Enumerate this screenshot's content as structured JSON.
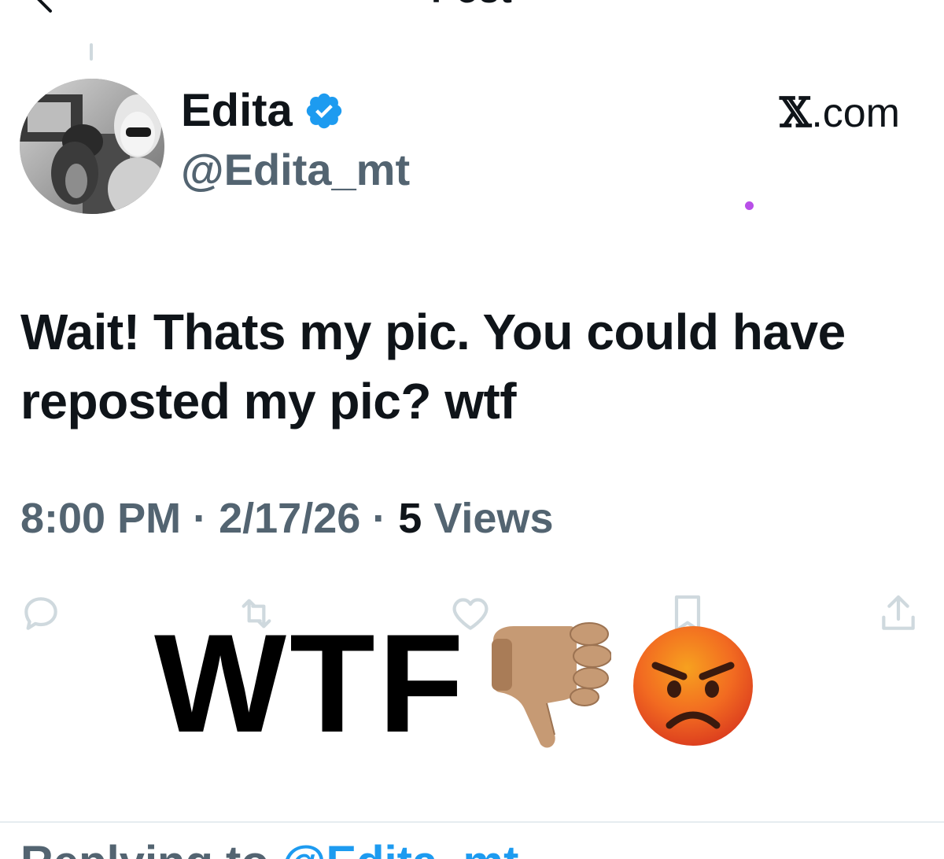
{
  "header": {
    "title": "Post",
    "back_icon": "arrow-left-icon"
  },
  "author": {
    "display_name": "Edita",
    "handle": "@Edita_mt",
    "verified": true,
    "verified_color": "#1d9bf0"
  },
  "brand": {
    "x_letter": "𝕏",
    "suffix": ".com"
  },
  "post": {
    "text": "Wait! Thats my pic. You could have reposted my pic? wtf",
    "time": "8:00 PM",
    "date": "2/17/26",
    "views_count": "5",
    "views_label": "Views",
    "separator": "·"
  },
  "actions": {
    "reply_icon": "reply-icon",
    "repost_icon": "repost-icon",
    "like_icon": "heart-icon",
    "bookmark_icon": "bookmark-icon",
    "share_icon": "share-icon"
  },
  "overlay": {
    "text": "WTF",
    "emoji_1": "thumbs-down-icon",
    "emoji_2": "angry-face-icon"
  },
  "reply_context": {
    "prefix": "Replying to ",
    "mention": "@Edita_mt"
  },
  "colors": {
    "primary_text": "#0f1419",
    "secondary_text": "#536471",
    "accent": "#1d9bf0",
    "divider": "#e6ecf0"
  }
}
